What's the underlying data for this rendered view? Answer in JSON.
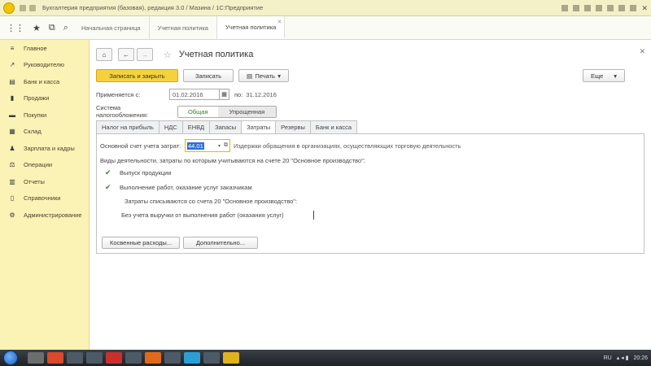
{
  "window": {
    "title": "Бухгалтерия предприятия (базовая), редакция 3.0 / Мазина / 1С:Предприятие"
  },
  "tabs": [
    {
      "label": "Начальная страница"
    },
    {
      "label": "Учетная политика"
    },
    {
      "label": "Учетная политика"
    }
  ],
  "sidebar": {
    "items": [
      {
        "label": "Главное",
        "icon": "menu-icon"
      },
      {
        "label": "Руководителю",
        "icon": "chart-icon"
      },
      {
        "label": "Банк и касса",
        "icon": "bank-icon"
      },
      {
        "label": "Продажи",
        "icon": "sales-icon"
      },
      {
        "label": "Покупки",
        "icon": "cart-icon"
      },
      {
        "label": "Склад",
        "icon": "warehouse-icon"
      },
      {
        "label": "Зарплата и кадры",
        "icon": "people-icon"
      },
      {
        "label": "Операции",
        "icon": "operations-icon"
      },
      {
        "label": "Отчеты",
        "icon": "reports-icon"
      },
      {
        "label": "Справочники",
        "icon": "books-icon"
      },
      {
        "label": "Администрирование",
        "icon": "gear-icon"
      }
    ]
  },
  "form": {
    "title": "Учетная политика",
    "save_close_label": "Записать и закрыть",
    "save_label": "Записать",
    "print_label": "Печать",
    "more_label": "Еще",
    "applies_label": "Применяется с:",
    "date_from": "01.02.2016",
    "to_label": "по:",
    "date_to": "31.12.2016",
    "tax_system_label": "Система налогообложения:",
    "tax_system_options": [
      "Общая",
      "Упрощенная"
    ],
    "tax_system_selected": "Общая"
  },
  "subtabs": [
    {
      "label": "Налог на прибыль"
    },
    {
      "label": "НДС"
    },
    {
      "label": "ЕНВД"
    },
    {
      "label": "Запасы"
    },
    {
      "label": "Затраты"
    },
    {
      "label": "Резервы"
    },
    {
      "label": "Банк и касса"
    }
  ],
  "costs": {
    "main_account_label": "Основной счет учета затрат:",
    "main_account_value": "44.01",
    "main_account_hint": "Издержки обращения в организациях, осуществляющих торговую деятельность",
    "activities_label": "Виды деятельности, затраты по которым учитываются на счете 20 \"Основное производство\":",
    "check_products": "Выпуск продукции",
    "check_services": "Выполнение работ, оказание услуг заказчикам",
    "write_off_text": "Затраты списываются со счета 20 \"Основное производство\":",
    "without_revenue_text": "Без учета выручки от выполнения работ (оказания услуг)",
    "indirect_button": "Косвенные расходы...",
    "extra_button": "Дополнительно..."
  },
  "taskbar": {
    "lang": "RU",
    "time": "20:26"
  }
}
